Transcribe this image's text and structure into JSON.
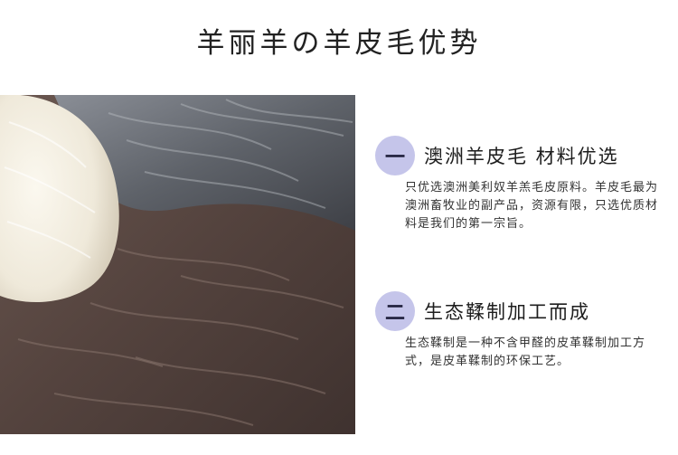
{
  "page": {
    "title": "羊丽羊の羊皮毛优势"
  },
  "features": [
    {
      "number": "一",
      "heading": "澳洲羊皮毛 材料优选",
      "body": "只优选澳洲美利奴羊羔毛皮原料。羊皮毛最为澳洲畜牧业的副产品，资源有限，只选优质材料是我们的第一宗旨。"
    },
    {
      "number": "二",
      "heading": "生态鞣制加工而成",
      "body": "生态鞣制是一种不含甲醛的皮革鞣制加工方式，是皮革鞣制的环保工艺。"
    }
  ],
  "colors": {
    "badge": "#c5c5ea",
    "white_fur": "#f3efe3",
    "grey_fur": "#6f737a",
    "brown_fur": "#5d4b45"
  }
}
